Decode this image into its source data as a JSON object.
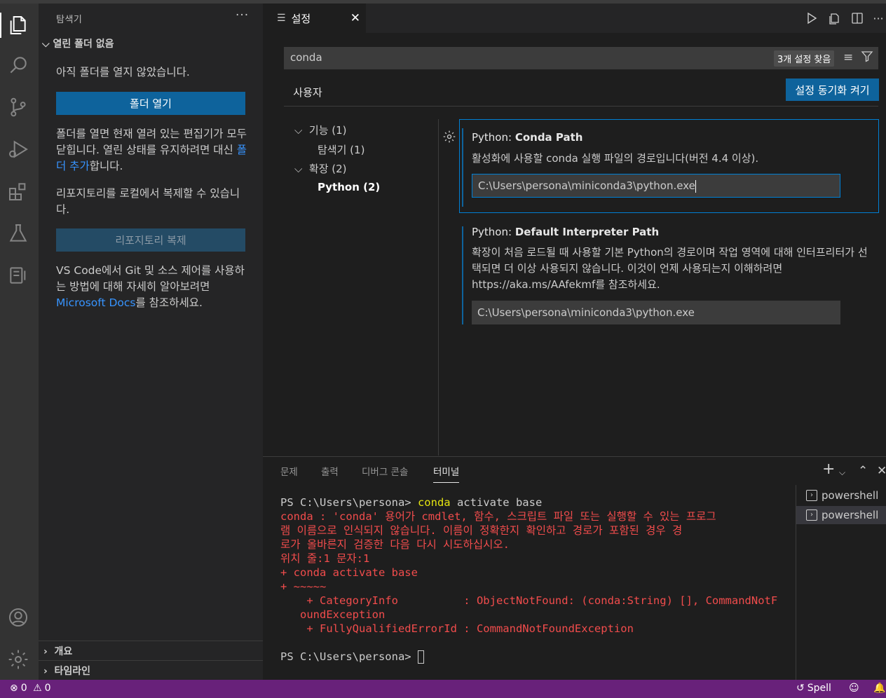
{
  "sidebar": {
    "title": "탐색기",
    "more": "···",
    "section": "열린 폴더 없음",
    "no_folder_text": "아직 폴더를 열지 않았습니다.",
    "open_folder_button": "폴더 열기",
    "open_info_1": "폴더를 열면 현재 열려 있는 편집기가 모두 닫힙니다. 열린 상태를 유지하려면 대신 ",
    "add_folder_link": "폴더 추가",
    "open_info_2": "합니다.",
    "clone_text": "리포지토리를 로컬에서 복제할 수 있습니다.",
    "clone_button": "리포지토리 복제",
    "git_text_1": "VS Code에서 Git 및 소스 제어를 사용하는 방법에 대해 자세히 알아보려면 ",
    "docs_link": "Microsoft Docs",
    "git_text_2": "를 참조하세요.",
    "outline": "개요",
    "timeline": "타임라인"
  },
  "editor": {
    "tab_label": "설정",
    "search": {
      "value": "conda",
      "found": "3개 설정 찾음"
    },
    "user_tab": "사용자",
    "sync_button": "설정 동기화 켜기",
    "toc": [
      {
        "label": "기능 (1)",
        "expanded": true
      },
      {
        "label": "탐색기 (1)"
      },
      {
        "label": "확장 (2)",
        "expanded": true
      },
      {
        "label": "Python (2)"
      }
    ],
    "settings": [
      {
        "category": "Python: ",
        "name": "Conda Path",
        "description": "활성화에 사용할 conda 실행 파일의 경로입니다(버전 4.4 이상).",
        "value": "C:\\Users\\persona\\miniconda3\\python.exe"
      },
      {
        "category": "Python: ",
        "name": "Default Interpreter Path",
        "description": "확장이 처음 로드될 때 사용할 기본 Python의 경로이며 작업 영역에 대해 인터프리터가 선택되면 더 이상 사용되지 않습니다. 이것이 언제 사용되는지 이해하려면 https://aka.ms/AAfekmf를 참조하세요.",
        "value": "C:\\Users\\persona\\miniconda3\\python.exe"
      }
    ]
  },
  "panel": {
    "tabs": [
      "문제",
      "출력",
      "디버그 콘솔",
      "터미널"
    ],
    "active_tab": "터미널",
    "terminal_lines": {
      "prompt1": "PS C:\\Users\\persona> ",
      "cmd_word": "conda",
      "cmd_rest": " activate base",
      "err1": "conda : 'conda' 용어가 cmdlet, 함수, 스크립트 파일 또는 실행할 수 있는 프로그",
      "err2": "램 이름으로 인식되지 않습니다. 이름이 정확한지 확인하고 경로가 포함된 경우 경",
      "err3": "로가 올바른지 검증한 다음 다시 시도하십시오.",
      "err4": "위치 줄:1 문자:1",
      "err5": "+ conda activate base",
      "err6": "+ ~~~~~",
      "err7": "    + CategoryInfo          : ObjectNotFound: (conda:String) [], CommandNotF",
      "err8": "   oundException",
      "err9": "    + FullyQualifiedErrorId : CommandNotFoundException",
      "prompt2": "PS C:\\Users\\persona> "
    },
    "terminals": [
      "powershell",
      "powershell"
    ]
  },
  "statusbar": {
    "errors": "0",
    "warnings": "0",
    "spell": "Spell"
  },
  "colors": {
    "accent": "#0e639c",
    "statusbar": "#68217a",
    "error": "#f14c4c"
  }
}
